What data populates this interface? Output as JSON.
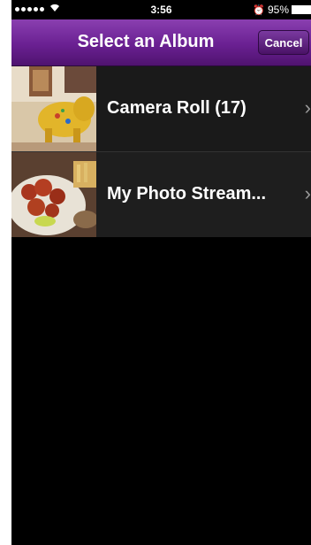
{
  "status": {
    "time": "3:56",
    "battery": "95%"
  },
  "navbar": {
    "title": "Select an Album",
    "cancel_label": "Cancel"
  },
  "albums": [
    {
      "label": "Camera Roll (17)",
      "thumb_icon": "elephant-photo-thumbnail"
    },
    {
      "label": "My Photo Stream...",
      "thumb_icon": "food-photo-thumbnail"
    }
  ],
  "colors": {
    "nav_top": "#8a3fb0",
    "nav_bottom": "#4f136f",
    "row_bg": "#1a1a1a",
    "background": "#000000"
  }
}
